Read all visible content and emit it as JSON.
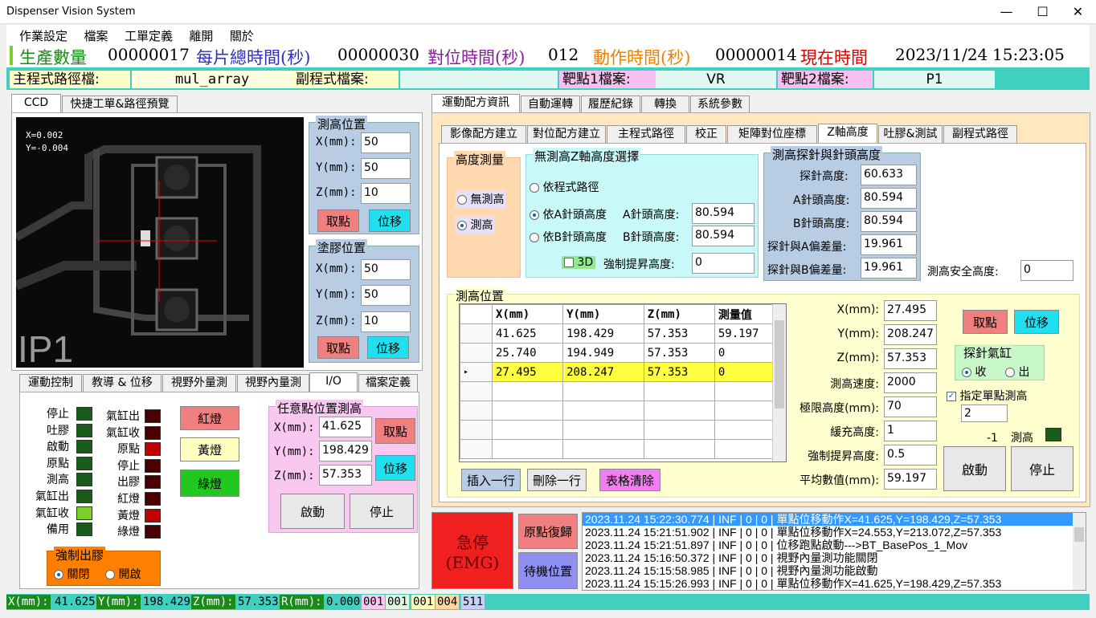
{
  "window": {
    "title": "Dispenser Vision System",
    "minimize": "—",
    "maximize": "☐",
    "close": "✕"
  },
  "menu": [
    "作業設定",
    "檔案",
    "工單定義",
    "離開",
    "關於"
  ],
  "stats": {
    "production_label": "生產數量",
    "production_value": "00000017",
    "total_time_label": "每片總時間(秒)",
    "total_time_value": "00000030",
    "align_time_label": "對位時間(秒)",
    "align_time_value": "012",
    "action_time_label": "動作時間(秒)",
    "action_time_value": "00000014",
    "now_label": "現在時間",
    "date": "2023/11/24",
    "time": "15:23:05"
  },
  "paths": {
    "main_label": "主程式路徑檔:",
    "main_value": "mul_array",
    "sub_label": "副程式檔案:",
    "sub_value": "",
    "target1_label": "靶點1檔案:",
    "target1_value": "VR",
    "target2_label": "靶點2檔案:",
    "target2_value": "P1"
  },
  "left_tabs": [
    "CCD",
    "快捷工單&路徑預覽"
  ],
  "camera": {
    "x_readout": "X=0.002",
    "y_readout": "Y=-0.004",
    "pcb_label": "IP1"
  },
  "measure_pos": {
    "title": "測高位置",
    "x_label": "X(mm):",
    "x": "50",
    "y_label": "Y(mm):",
    "y": "50",
    "z_label": "Z(mm):",
    "z": "10",
    "pick": "取點",
    "move": "位移"
  },
  "glue_pos": {
    "title": "塗膠位置",
    "x_label": "X(mm):",
    "x": "50",
    "y_label": "Y(mm):",
    "y": "50",
    "z_label": "Z(mm):",
    "z": "10",
    "pick": "取點",
    "move": "位移"
  },
  "bottom_tabs": [
    "運動控制",
    "教導 & 位移",
    "視野外量測",
    "視野內量測",
    "I/O",
    "檔案定義"
  ],
  "io": {
    "left_labels": [
      "停止",
      "吐膠",
      "啟動",
      "原點",
      "測高",
      "氣缸出",
      "氣缸收",
      "備用"
    ],
    "right_labels": [
      "氣缸出",
      "氣缸收",
      "原點",
      "停止",
      "出膠",
      "紅燈",
      "黃燈",
      "綠燈"
    ],
    "red_light": "紅燈",
    "yellow_light": "黃燈",
    "green_light": "綠燈",
    "force_title": "強制出膠",
    "off": "關閉",
    "on": "開啟"
  },
  "any_point": {
    "title": "任意點位置測高",
    "x_label": "X(mm):",
    "x": "41.625",
    "y_label": "Y(mm):",
    "y": "198.429",
    "z_label": "Z(mm):",
    "z": "57.353",
    "pick": "取點",
    "move": "位移",
    "start": "啟動",
    "stop": "停止"
  },
  "right_tabs": [
    "運動配方資訊",
    "自動運轉",
    "履歷紀錄",
    "轉換",
    "系統參數"
  ],
  "sub_tabs": [
    "影像配方建立",
    "對位配方建立",
    "主程式路徑",
    "校正",
    "矩陣對位座標",
    "Z軸高度",
    "吐膠&測試",
    "副程式路徑"
  ],
  "height_measure": {
    "title": "高度測量",
    "no_measure": "無測高",
    "measure": "測高"
  },
  "z_select": {
    "title": "無測高Z軸高度選擇",
    "opt1": "依程式路徑",
    "opt2": "依A針頭高度",
    "opt3": "依B針頭高度",
    "a_label": "A針頭高度:",
    "a_value": "80.594",
    "b_label": "B針頭高度:",
    "b_value": "80.594",
    "three_d": "3D",
    "force_label": "強制提昇高度:",
    "force_value": "0"
  },
  "probe": {
    "title": "測高探針與針頭高度",
    "probe_label": "探針高度:",
    "probe_value": "60.633",
    "a_label": "A針頭高度:",
    "a_value": "80.594",
    "b_label": "B針頭高度:",
    "b_value": "80.594",
    "da_label": "探針與A偏差量:",
    "da_value": "19.961",
    "db_label": "探針與B偏差量:",
    "db_value": "19.961"
  },
  "safe_height": {
    "label": "測高安全高度:",
    "value": "0"
  },
  "table": {
    "title": "測高位置",
    "headers": [
      "X(mm)",
      "Y(mm)",
      "Z(mm)",
      "測量值"
    ],
    "rows": [
      [
        "41.625",
        "198.429",
        "57.353",
        "59.197"
      ],
      [
        "25.740",
        "194.949",
        "57.353",
        "0"
      ],
      [
        "27.495",
        "208.247",
        "57.353",
        "0"
      ]
    ],
    "insert": "插入一行",
    "delete": "刪除一行",
    "clear": "表格清除"
  },
  "measure_params": {
    "x_label": "X(mm):",
    "x": "27.495",
    "y_label": "Y(mm):",
    "y": "208.247",
    "z_label": "Z(mm):",
    "z": "57.353",
    "speed_label": "測高速度:",
    "speed": "2000",
    "limit_label": "極限高度(mm):",
    "limit": "70",
    "buffer_label": "緩充高度:",
    "buffer": "1",
    "force_label": "強制提昇高度:",
    "force": "0.5",
    "avg_label": "平均數值(mm):",
    "avg": "59.197"
  },
  "probe_ctrl": {
    "pick": "取點",
    "move": "位移",
    "cyl_title": "探針氣缸",
    "retract": "收",
    "extend": "出",
    "single_label": "指定單點測高",
    "spin_value": "2",
    "minus_one": "-1",
    "measure_led_label": "測高",
    "start": "啟動",
    "stop": "停止"
  },
  "emg": {
    "line1": "急停",
    "line2": "(EMG)",
    "home": "原點復歸",
    "standby": "待機位置"
  },
  "log": [
    "2023.11.24 15:22:30.774 | INF | 0 | 0 | 單點位移動作X=41.625,Y=198.429,Z=57.353",
    "2023.11.24 15:21:51.902 | INF | 0 | 0 | 單點位移動作X=24.553,Y=213.072,Z=57.353",
    "2023.11.24 15:21:51.897 | INF | 0 | 0 | 位移跑點啟動--->BT_BasePos_1_Mov",
    "2023.11.24 15:16:50.372 | INF | 0 | 0 | 視野內量測功能關閉",
    "2023.11.24 15:15:58.985 | INF | 0 | 0 | 視野內量測功能啟動",
    "2023.11.24 15:15:26.993 | INF | 0 | 0 | 單點位移動作X=41.625,Y=198.429,Z=57.353"
  ],
  "status": {
    "x_label": "X(mm):",
    "x": "41.625",
    "y_label": "Y(mm):",
    "y": "198.429",
    "z_label": "Z(mm):",
    "z": "57.353",
    "r_label": "R(mm):",
    "r": "0.000",
    "c1": "001",
    "c2": "001",
    "c3": "001",
    "c4": "004",
    "c5": "511"
  },
  "colors": {
    "teal": "#40d0c0",
    "green_led": "#1a5c1a",
    "lit_led": "#7cd02a",
    "dark_red_led": "#4a0000",
    "red_led": "#c00000"
  }
}
